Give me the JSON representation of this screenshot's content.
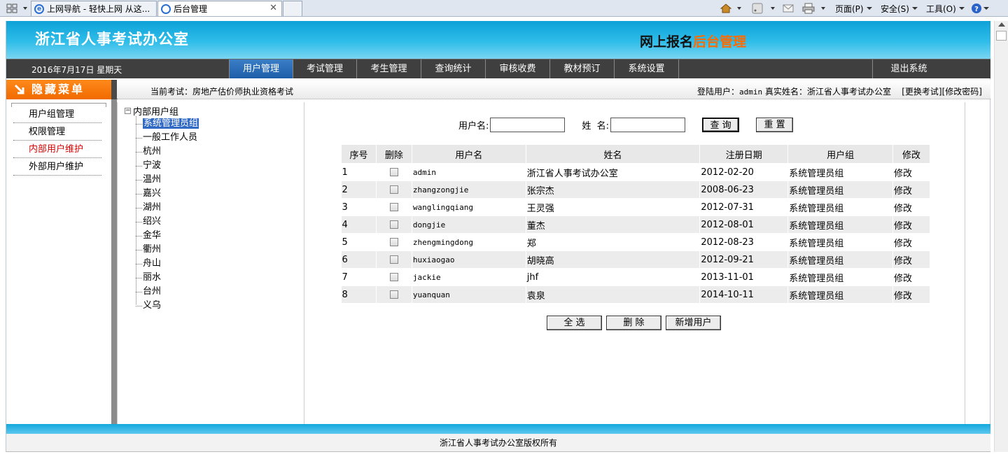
{
  "browser": {
    "tabs": [
      {
        "title": "上网导航 - 轻快上网 从这..."
      },
      {
        "title": "后台管理"
      }
    ],
    "toolbar": {
      "page_label": "页面(P)",
      "safety_label": "安全(S)",
      "tools_label": "工具(O)"
    }
  },
  "banner": {
    "org_name": "浙江省人事考试办公室",
    "system_prefix": "网上报名",
    "system_highlight": "后台管理"
  },
  "nav": {
    "date": "2016年7月17日  星期天",
    "items": [
      "用户管理",
      "考试管理",
      "考生管理",
      "查询统计",
      "审核收费",
      "教材预订",
      "系统设置"
    ],
    "exit_label": "退出系统",
    "active_index": 0
  },
  "left_menu": {
    "header": "隐藏菜单",
    "items": [
      "用户组管理",
      "权限管理",
      "内部用户维护",
      "外部用户维护"
    ],
    "active_index": 2
  },
  "info": {
    "current_exam_label": "当前考试：",
    "current_exam": "房地产估价师执业资格考试",
    "login_label": "登陆用户：",
    "login_user": "admin",
    "real_name_label": "真实姓名：",
    "real_name": "浙江省人事考试办公室",
    "change_exam": "[更换考试]",
    "change_password": "[修改密码]"
  },
  "tree": {
    "root": "内部用户组",
    "items": [
      "系统管理员组",
      "一般工作人员",
      "杭州",
      "宁波",
      "温州",
      "嘉兴",
      "湖州",
      "绍兴",
      "金华",
      "衢州",
      "舟山",
      "丽水",
      "台州",
      "义乌"
    ],
    "selected_index": 0
  },
  "search": {
    "username_label": "用户名:",
    "name_label": "姓  名:",
    "username_value": "",
    "name_value": "",
    "query_button": "查 询",
    "reset_button": "重 置"
  },
  "grid": {
    "headers": [
      "序号",
      "删除",
      "用户名",
      "姓名",
      "注册日期",
      "用户组",
      "修改"
    ],
    "rows": [
      {
        "no": "1",
        "username": "admin",
        "name": "浙江省人事考试办公室",
        "date": "2012-02-20",
        "group": "系统管理员组",
        "edit": "修改"
      },
      {
        "no": "2",
        "username": "zhangzongjie",
        "name": "张宗杰",
        "date": "2008-06-23",
        "group": "系统管理员组",
        "edit": "修改"
      },
      {
        "no": "3",
        "username": "wanglingqiang",
        "name": "王灵强",
        "date": "2012-07-31",
        "group": "系统管理员组",
        "edit": "修改"
      },
      {
        "no": "4",
        "username": "dongjie",
        "name": "董杰",
        "date": "2012-08-01",
        "group": "系统管理员组",
        "edit": "修改"
      },
      {
        "no": "5",
        "username": "zhengmingdong",
        "name": "郑",
        "date": "2012-08-23",
        "group": "系统管理员组",
        "edit": "修改"
      },
      {
        "no": "6",
        "username": "huxiaogao",
        "name": "胡晓高",
        "date": "2012-09-21",
        "group": "系统管理员组",
        "edit": "修改"
      },
      {
        "no": "7",
        "username": "jackie",
        "name": "jhf",
        "date": "2013-11-01",
        "group": "系统管理员组",
        "edit": "修改"
      },
      {
        "no": "8",
        "username": "yuanquan",
        "name": "袁泉",
        "date": "2014-10-11",
        "group": "系统管理员组",
        "edit": "修改"
      }
    ]
  },
  "actions": {
    "select_all": "全 选",
    "delete": "删 除",
    "add_user": "新增用户"
  },
  "footer": {
    "copyright": "浙江省人事考试办公室版权所有"
  },
  "colors": {
    "banner_blue": "#0da2d8",
    "accent_orange": "#ff6a00",
    "nav_dark": "#3f3f3f",
    "nav_active": "#1d5ea9",
    "menu_red": "#dd0000"
  }
}
